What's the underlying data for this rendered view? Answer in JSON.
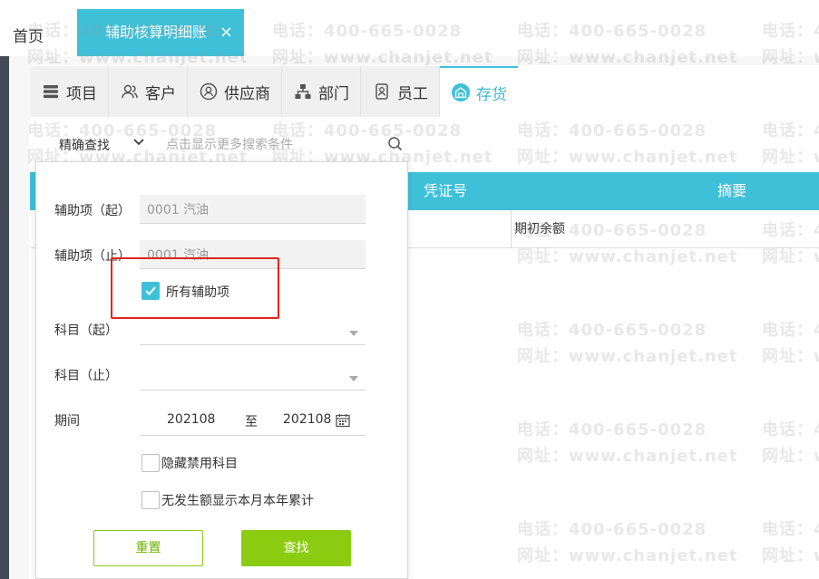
{
  "topbar": {
    "home_label": "首页",
    "active_tab_label": "辅助核算明细账",
    "close_icon": "×"
  },
  "category_tabs": [
    {
      "label": "项目",
      "icon": "list-icon",
      "active": false
    },
    {
      "label": "客户",
      "icon": "users-icon",
      "active": false
    },
    {
      "label": "供应商",
      "icon": "supplier-icon",
      "active": false
    },
    {
      "label": "部门",
      "icon": "org-icon",
      "active": false
    },
    {
      "label": "员工",
      "icon": "badge-icon",
      "active": false
    },
    {
      "label": "存货",
      "icon": "warehouse-icon",
      "active": true
    }
  ],
  "search": {
    "mode_label": "精确查找",
    "placeholder": "点击显示更多搜索条件"
  },
  "table": {
    "columns": [
      "凭证号",
      "摘要"
    ],
    "rows": [
      [
        "",
        "期初余额"
      ]
    ]
  },
  "filter": {
    "aux_from_label": "辅助项（起）",
    "aux_from_value": "0001 汽油",
    "aux_to_label": "辅助项（止）",
    "aux_to_value": "0001 汽油",
    "all_aux_label": "所有辅助项",
    "all_aux_checked": true,
    "subject_from_label": "科目（起）",
    "subject_to_label": "科目（止）",
    "period_label": "期间",
    "period_from": "202108",
    "period_sep": "至",
    "period_to": "202108",
    "hide_disabled_label": "隐藏禁用科目",
    "show_no_amount_label": "无发生额显示本月本年累计",
    "reset_label": "重置",
    "find_label": "查找"
  },
  "watermark": {
    "phone": "电话：400-665-0028",
    "site": "网址：www.chanjet.net"
  },
  "colors": {
    "accent": "#3fc0d9",
    "primary_button": "#8ccc10",
    "highlight": "#e0261c"
  }
}
